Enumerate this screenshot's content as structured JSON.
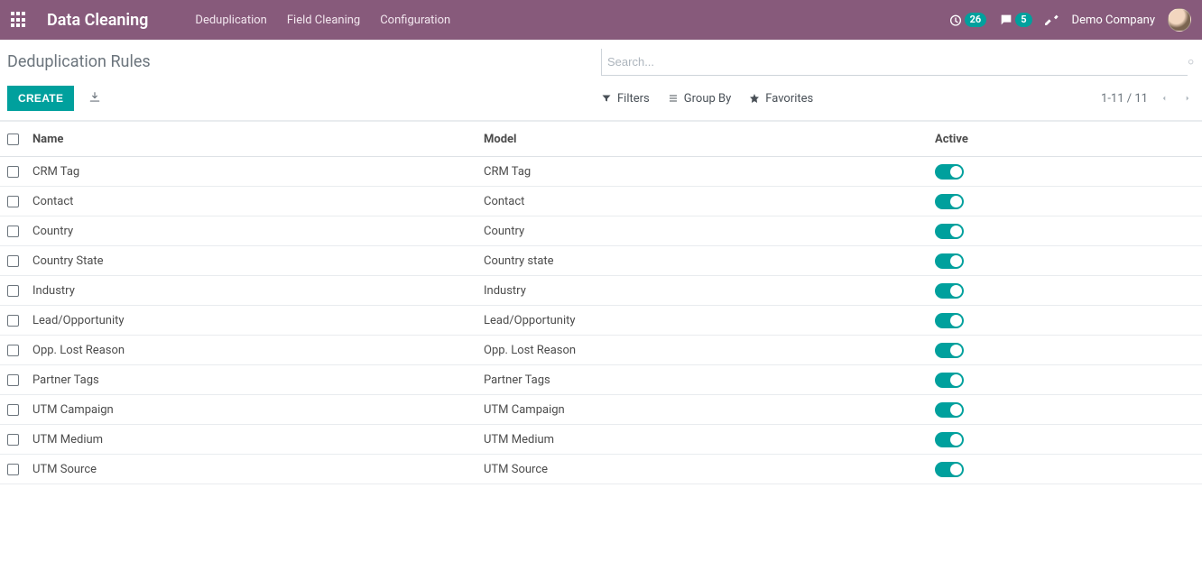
{
  "colors": {
    "brand": "#875a7b",
    "teal": "#00a09d"
  },
  "header": {
    "app_name": "Data Cleaning",
    "menu": [
      "Deduplication",
      "Field Cleaning",
      "Configuration"
    ],
    "activity_count": "26",
    "messages_count": "5",
    "company": "Demo Company"
  },
  "breadcrumb": "Deduplication Rules",
  "buttons": {
    "create": "CREATE"
  },
  "search": {
    "placeholder": "Search..."
  },
  "filters": {
    "filters": "Filters",
    "groupby": "Group By",
    "favorites": "Favorites"
  },
  "pager": {
    "range": "1-11",
    "sep": " / ",
    "total": "11"
  },
  "columns": {
    "name": "Name",
    "model": "Model",
    "active": "Active"
  },
  "rows": [
    {
      "name": "CRM Tag",
      "model": "CRM Tag",
      "active": true
    },
    {
      "name": "Contact",
      "model": "Contact",
      "active": true
    },
    {
      "name": "Country",
      "model": "Country",
      "active": true
    },
    {
      "name": "Country State",
      "model": "Country state",
      "active": true
    },
    {
      "name": "Industry",
      "model": "Industry",
      "active": true
    },
    {
      "name": "Lead/Opportunity",
      "model": "Lead/Opportunity",
      "active": true
    },
    {
      "name": "Opp. Lost Reason",
      "model": "Opp. Lost Reason",
      "active": true
    },
    {
      "name": "Partner Tags",
      "model": "Partner Tags",
      "active": true
    },
    {
      "name": "UTM Campaign",
      "model": "UTM Campaign",
      "active": true
    },
    {
      "name": "UTM Medium",
      "model": "UTM Medium",
      "active": true
    },
    {
      "name": "UTM Source",
      "model": "UTM Source",
      "active": true
    }
  ]
}
